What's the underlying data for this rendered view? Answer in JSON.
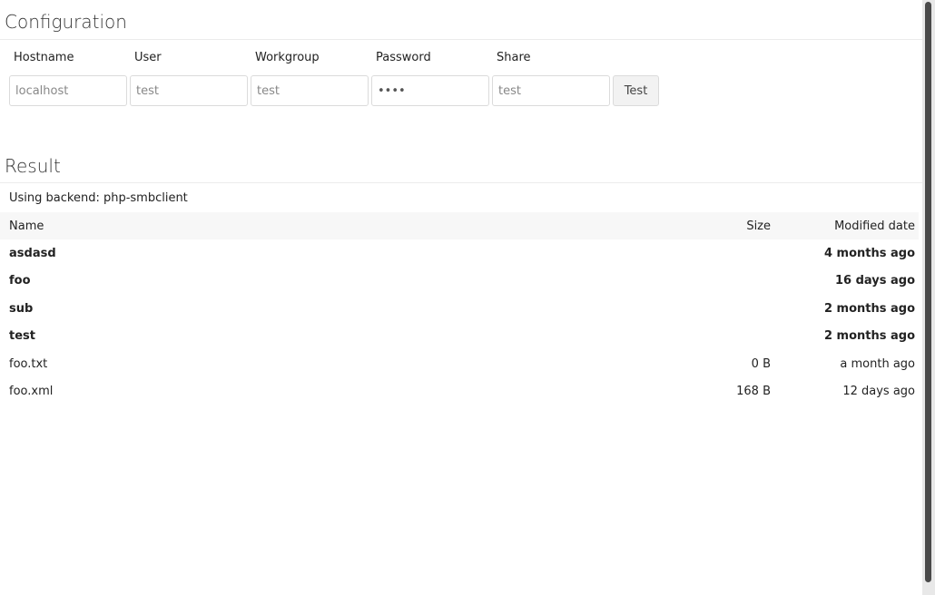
{
  "configuration": {
    "title": "Configuration",
    "fields": [
      {
        "label": "Hostname",
        "placeholder": "localhost",
        "type": "text"
      },
      {
        "label": "User",
        "placeholder": "test",
        "type": "text"
      },
      {
        "label": "Workgroup",
        "placeholder": "test",
        "type": "text"
      },
      {
        "label": "Password",
        "value": "test",
        "type": "password"
      },
      {
        "label": "Share",
        "placeholder": "test",
        "type": "text"
      }
    ],
    "test_button_label": "Test"
  },
  "result": {
    "title": "Result",
    "backend_text": "Using backend: php-smbclient",
    "columns": {
      "name": "Name",
      "size": "Size",
      "modified": "Modified date"
    },
    "rows": [
      {
        "name": "asdasd",
        "size": "",
        "modified": "4 months ago",
        "is_dir": true
      },
      {
        "name": "foo",
        "size": "",
        "modified": "16 days ago",
        "is_dir": true
      },
      {
        "name": "sub",
        "size": "",
        "modified": "2 months ago",
        "is_dir": true
      },
      {
        "name": "test",
        "size": "",
        "modified": "2 months ago",
        "is_dir": true
      },
      {
        "name": "foo.txt",
        "size": "0 B",
        "modified": "a month ago",
        "is_dir": false
      },
      {
        "name": "foo.xml",
        "size": "168 B",
        "modified": "12 days ago",
        "is_dir": false
      }
    ]
  }
}
